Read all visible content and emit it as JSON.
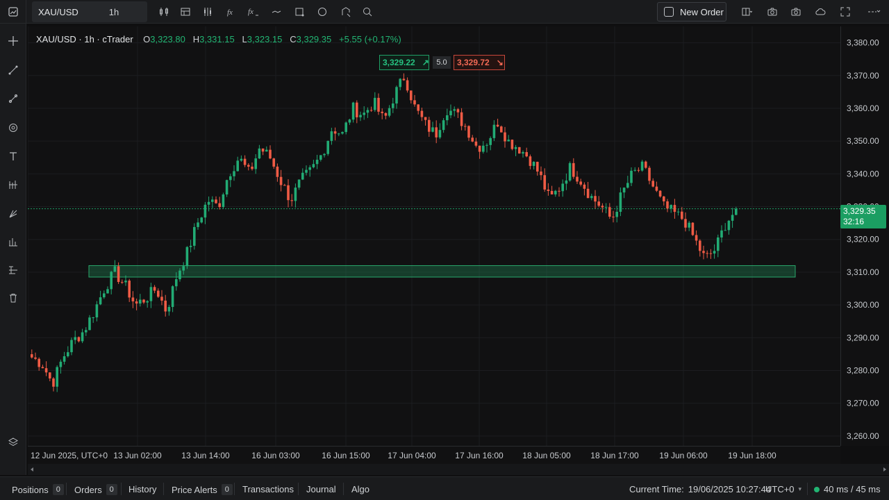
{
  "topbar": {
    "symbol": "XAU/USD",
    "timeframe": "1h",
    "new_order_label": "New Order"
  },
  "legend": {
    "title": "XAU/USD · 1h · cTrader",
    "o_label": "O",
    "o_value": "3,323.80",
    "h_label": "H",
    "h_value": "3,331.15",
    "l_label": "L",
    "l_value": "3,323.15",
    "c_label": "C",
    "c_value": "3,329.35",
    "change": "+5.55 (+0.17%)"
  },
  "quote": {
    "buy_price": "3,329.22",
    "spread": "5.0",
    "sell_price": "3,329.72"
  },
  "current_price": {
    "price": "3,329.35",
    "countdown": "32:16"
  },
  "bottombar": {
    "positions_label": "Positions",
    "positions_count": "0",
    "orders_label": "Orders",
    "orders_count": "0",
    "history_label": "History",
    "price_alerts_label": "Price Alerts",
    "price_alerts_count": "0",
    "transactions_label": "Transactions",
    "journal_label": "Journal",
    "algo_label": "Algo",
    "current_time_label": "Current Time:",
    "current_time_value": "19/06/2025 10:27:44",
    "timezone": "UTC+0",
    "latency": "40 ms / 45 ms"
  },
  "colors": {
    "bull": "#22ab74",
    "bear": "#ef5b45",
    "zone": "#1f8f5c",
    "background": "#111112"
  },
  "chart_data": {
    "type": "candlestick",
    "title": "XAU/USD · 1h · cTrader",
    "y_ticks": [
      "3,380.00",
      "3,370.00",
      "3,360.00",
      "3,350.00",
      "3,340.00",
      "3,330.00",
      "3,320.00",
      "3,310.00",
      "3,300.00",
      "3,290.00",
      "3,280.00",
      "3,270.00",
      "3,260.00"
    ],
    "ylim": [
      3257,
      3385
    ],
    "x_ticks": [
      "12 Jun 2025, UTC+0",
      "13 Jun 02:00",
      "13 Jun 14:00",
      "16 Jun 03:00",
      "16 Jun 15:00",
      "17 Jun 04:00",
      "17 Jun 16:00",
      "18 Jun 05:00",
      "18 Jun 17:00",
      "19 Jun 06:00",
      "19 Jun 18:00"
    ],
    "support_zone": [
      3308.5,
      3312.0
    ],
    "current_price_line": 3329.35,
    "close_path": [
      3284,
      3282,
      3276,
      3284,
      3289,
      3292,
      3298,
      3305,
      3310,
      3306,
      3300,
      3302,
      3305,
      3298,
      3309,
      3316,
      3325,
      3332,
      3330,
      3340,
      3345,
      3340,
      3348,
      3345,
      3338,
      3332,
      3338,
      3341,
      3346,
      3354,
      3352,
      3360,
      3358,
      3362,
      3356,
      3364,
      3370,
      3360,
      3355,
      3352,
      3360,
      3358,
      3354,
      3348,
      3350,
      3356,
      3350,
      3348,
      3345,
      3340,
      3332,
      3336,
      3342,
      3338,
      3333,
      3330,
      3326,
      3334,
      3340,
      3342,
      3336,
      3330,
      3328,
      3326,
      3320,
      3314,
      3317,
      3325,
      3329
    ]
  }
}
